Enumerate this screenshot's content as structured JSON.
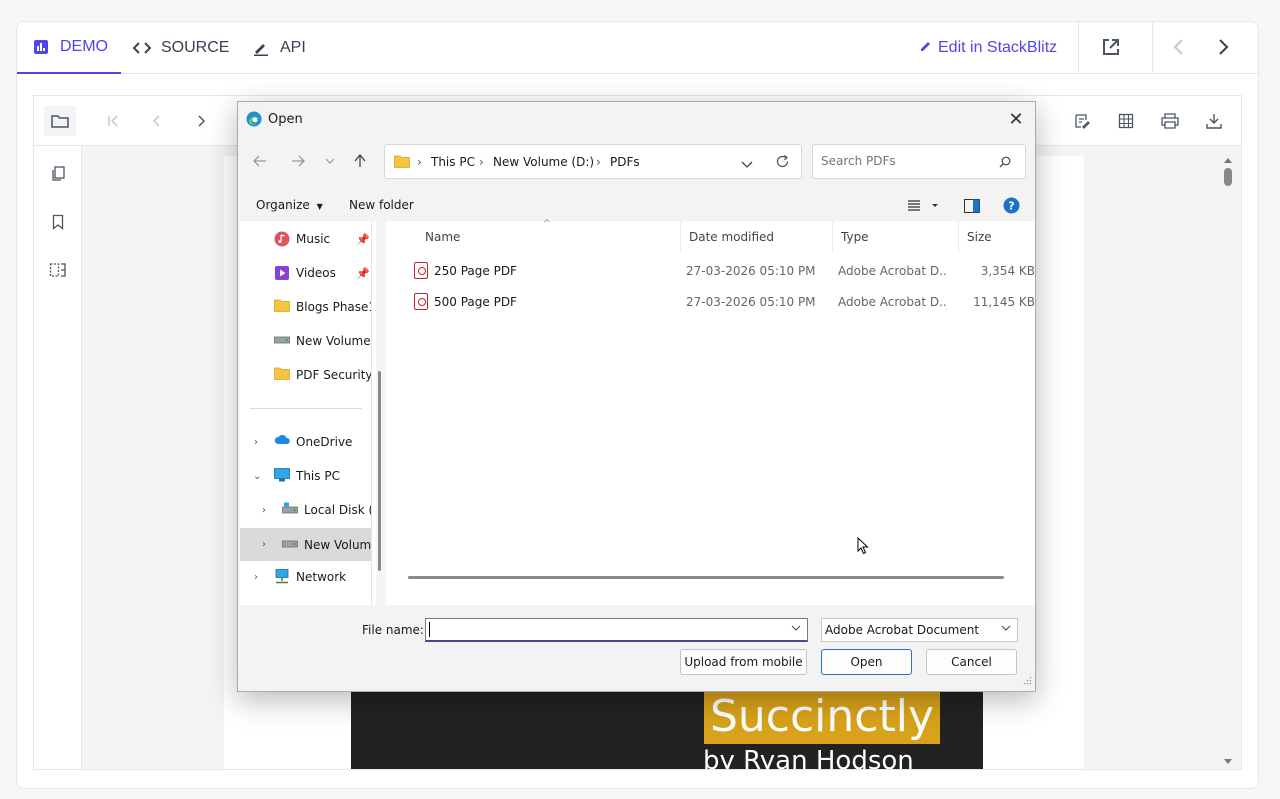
{
  "topbar": {
    "tabs": [
      {
        "label": "DEMO",
        "icon": "bar-chart-icon"
      },
      {
        "label": "SOURCE",
        "icon": "code-icon"
      },
      {
        "label": "API",
        "icon": "pen-icon"
      }
    ],
    "edit_label": "Edit in StackBlitz",
    "accent": "#4f46e5"
  },
  "viewer": {
    "cover_title": "Succinctly",
    "cover_author": "by Ryan Hodson"
  },
  "dialog": {
    "title": "Open",
    "breadcrumb": [
      "This PC",
      "New Volume (D:)",
      "PDFs"
    ],
    "search_placeholder": "Search PDFs",
    "organize_label": "Organize",
    "new_folder_label": "New folder",
    "nav_items": [
      {
        "label": "Music",
        "icon": "music-icon",
        "pinned": true
      },
      {
        "label": "Videos",
        "icon": "video-icon",
        "pinned": true
      },
      {
        "label": "Blogs Phase1",
        "icon": "folder-icon"
      },
      {
        "label": "New Volume",
        "icon": "drive-icon"
      },
      {
        "label": "PDF Security",
        "icon": "folder-icon"
      },
      {
        "label": "OneDrive",
        "icon": "cloud-icon"
      },
      {
        "label": "This PC",
        "icon": "computer-icon"
      },
      {
        "label": "Local Disk (",
        "icon": "drive-icon"
      },
      {
        "label": "New Volum",
        "icon": "drive-icon"
      },
      {
        "label": "Network",
        "icon": "network-icon"
      }
    ],
    "columns": [
      "Name",
      "Date modified",
      "Type",
      "Size"
    ],
    "files": [
      {
        "name": "250 Page PDF",
        "date": "27-03-2026 05:10 PM",
        "type": "Adobe Acrobat D...",
        "size": "3,354 KB"
      },
      {
        "name": "500 Page PDF",
        "date": "27-03-2026 05:10 PM",
        "type": "Adobe Acrobat D...",
        "size": "11,145 KB"
      }
    ],
    "file_name_label": "File name:",
    "file_name_value": "",
    "file_type_value": "Adobe Acrobat Document",
    "upload_label": "Upload from mobile",
    "open_label": "Open",
    "cancel_label": "Cancel"
  }
}
